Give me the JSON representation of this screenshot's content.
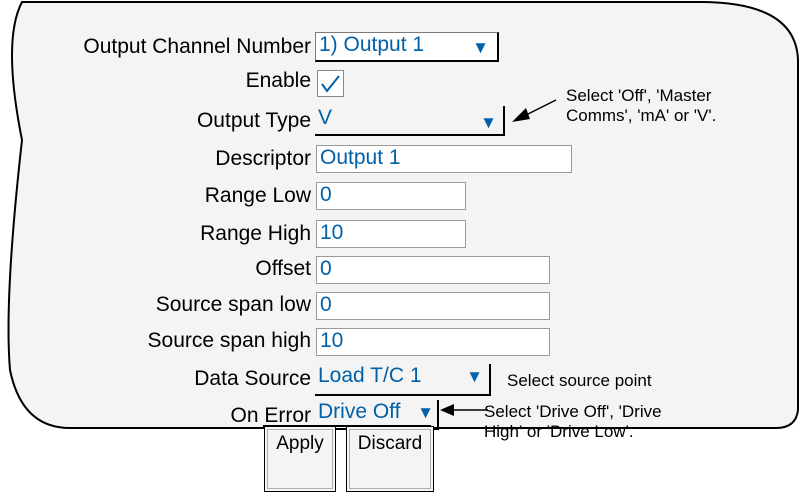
{
  "colors": {
    "panel_bg": "#f4f4f4",
    "field_text": "#0060a8",
    "border": "#000000"
  },
  "form": {
    "fields": [
      {
        "label": "Output Channel Number",
        "value": "1) Output 1",
        "kind": "select"
      },
      {
        "label": "Enable",
        "value": "checked",
        "kind": "checkbox"
      },
      {
        "label": "Output Type",
        "value": "V",
        "kind": "select"
      },
      {
        "label": "Descriptor",
        "value": "Output 1",
        "kind": "text"
      },
      {
        "label": "Range Low",
        "value": "0",
        "kind": "text"
      },
      {
        "label": "Range High",
        "value": "10",
        "kind": "text"
      },
      {
        "label": "Offset",
        "value": "0",
        "kind": "text"
      },
      {
        "label": "Source span low",
        "value": "0",
        "kind": "text"
      },
      {
        "label": "Source span high",
        "value": "10",
        "kind": "text"
      },
      {
        "label": "Data Source",
        "value": "Load T/C 1",
        "kind": "select"
      },
      {
        "label": "On Error",
        "value": "Drive Off",
        "kind": "select"
      }
    ]
  },
  "annotations": {
    "output_type_note_line1": "Select 'Off', 'Master",
    "output_type_note_line2": "Comms', 'mA' or 'V'.",
    "data_source_note": "Select source point",
    "on_error_note_line1": "Select 'Drive Off', 'Drive",
    "on_error_note_line2": "High' or 'Drive Low'."
  },
  "icons": {
    "dropdown": "dropdown-arrow-icon",
    "check": "checkmark-icon",
    "pointer": "pointer-arrow-icon"
  },
  "buttons": {
    "apply": "Apply",
    "discard": "Discard"
  }
}
